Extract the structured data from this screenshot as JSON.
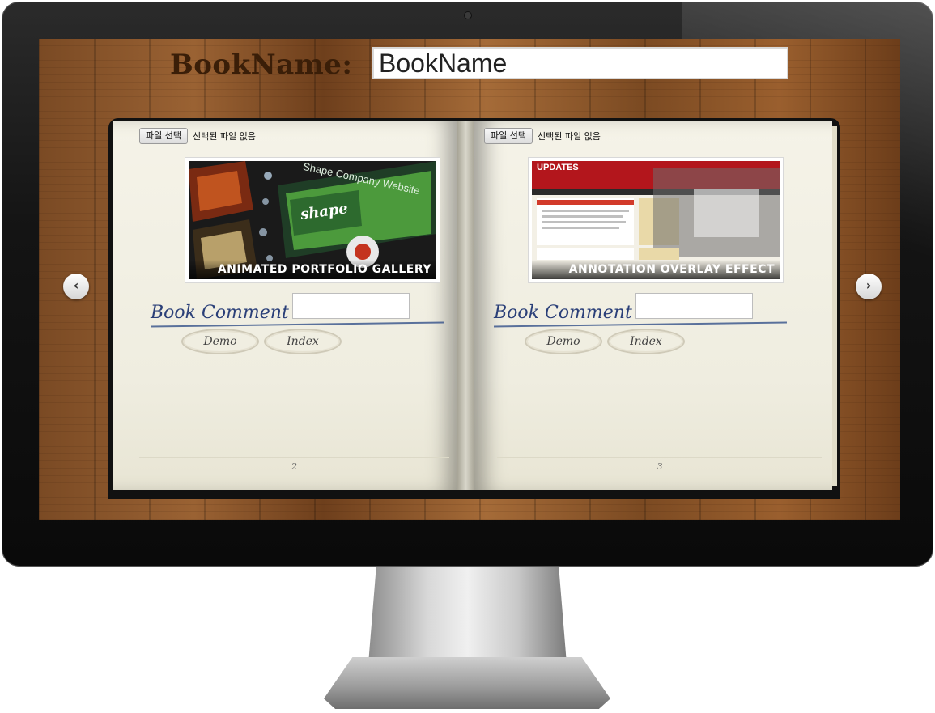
{
  "header": {
    "label": "BookName:",
    "input_value": "BookName"
  },
  "pages": [
    {
      "file_button": "파일 선택",
      "file_status": "선택된 파일 없음",
      "thumbnail": {
        "title": "Shape Company Website",
        "logo": "shape",
        "caption": "ANIMATED PORTFOLIO GALLERY"
      },
      "comment_label": "Book Comment",
      "comment_value": "",
      "buttons": [
        "Demo",
        "Index"
      ],
      "page_number": "2"
    },
    {
      "file_button": "파일 선택",
      "file_status": "선택된 파일 없음",
      "thumbnail": {
        "title": "UPDATES",
        "logo": "",
        "caption": "ANNOTATION OVERLAY EFFECT"
      },
      "comment_label": "Book Comment",
      "comment_value": "",
      "buttons": [
        "Demo",
        "Index"
      ],
      "page_number": "3"
    }
  ],
  "nav": {
    "prev_icon": "chevron-left-icon",
    "next_icon": "chevron-right-icon"
  }
}
